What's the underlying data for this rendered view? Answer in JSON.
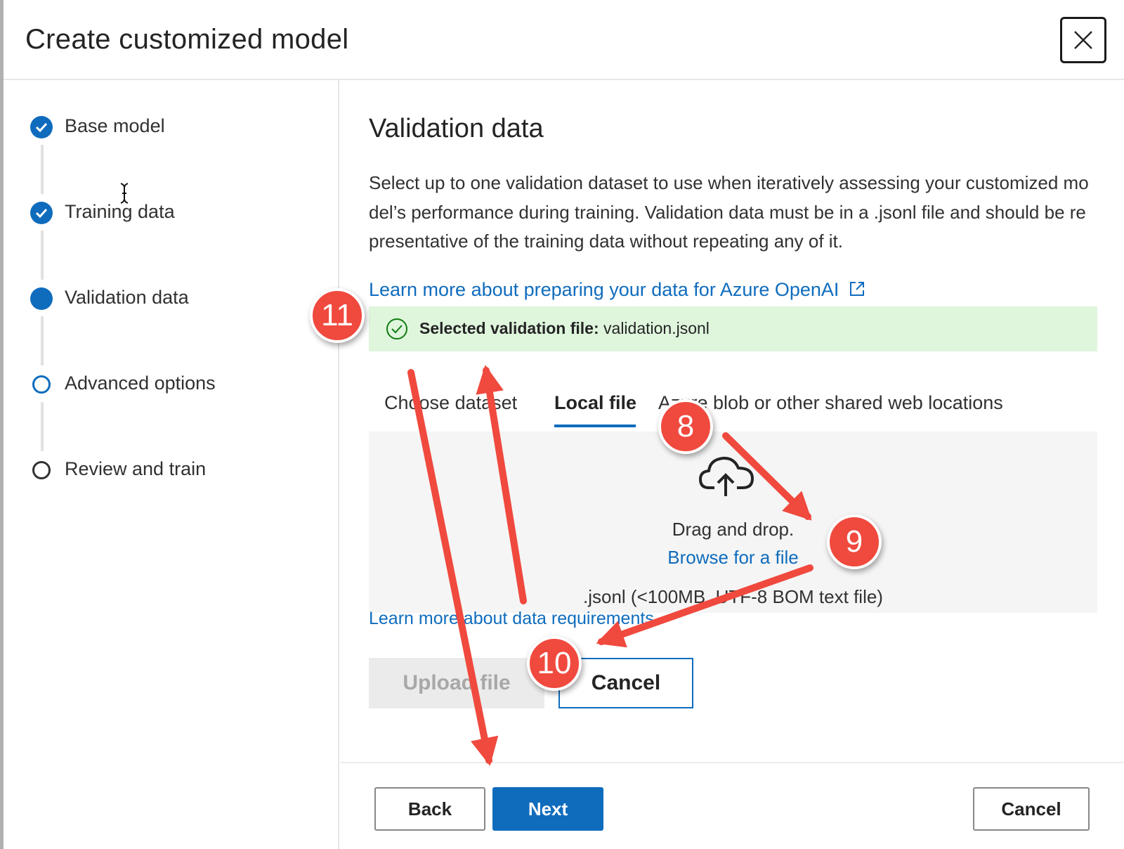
{
  "dialog": {
    "title": "Create customized model",
    "close_icon": "close-icon"
  },
  "steps": [
    {
      "label": "Base model",
      "state": "completed"
    },
    {
      "label": "Training data",
      "state": "completed"
    },
    {
      "label": "Validation data",
      "state": "current"
    },
    {
      "label": "Advanced options",
      "state": "pending"
    },
    {
      "label": "Review and train",
      "state": "pending"
    }
  ],
  "main": {
    "title": "Validation data",
    "description": "Select up to one validation dataset to use when iteratively assessing your customized model’s performance during training. Validation data must be in a .jsonl file and should be representative of the training data without repeating any of it.",
    "learn_link": "Learn more about preparing your data for Azure OpenAI",
    "success": {
      "label": "Selected validation file:",
      "value": "validation.jsonl"
    },
    "tabs": [
      {
        "label": "Choose dataset",
        "active": false
      },
      {
        "label": "Local file",
        "active": true
      },
      {
        "label": "Azure blob or other shared web locations",
        "active": false
      }
    ],
    "dropzone": {
      "instruction": "Drag and drop.",
      "browse_link": "Browse for a file",
      "file_hint": ".jsonl (<100MB, UTF-8 BOM text file)"
    },
    "requirements_link": "Learn more about data requirements",
    "upload_button": "Upload file",
    "cancel_upload_button": "Cancel"
  },
  "footer": {
    "back": "Back",
    "next": "Next",
    "cancel": "Cancel"
  },
  "annotations": [
    "8",
    "9",
    "10",
    "11"
  ],
  "colors": {
    "accent": "#0f6cbd",
    "success_bg": "#dff6dd",
    "success_icon": "#107c10",
    "annotation": "#f0493e"
  }
}
